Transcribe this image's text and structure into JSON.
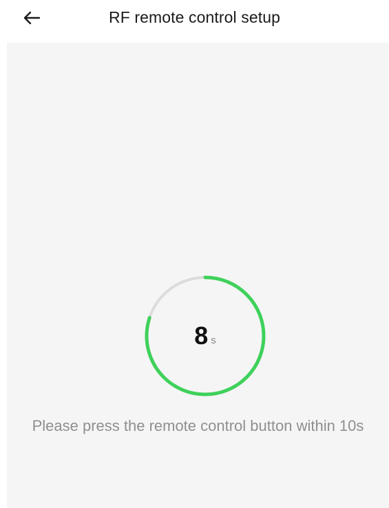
{
  "header": {
    "title": "RF remote control setup",
    "back_icon": "arrow-left-icon"
  },
  "timer": {
    "value": "8",
    "unit": "s",
    "total_seconds": 10,
    "remaining_seconds": 8,
    "progress_color": "#3fd15b",
    "track_color": "#dcdcdc"
  },
  "instruction": "Please press the remote control button within 10s",
  "colors": {
    "content_background": "#f5f5f5",
    "page_background": "#ffffff"
  }
}
